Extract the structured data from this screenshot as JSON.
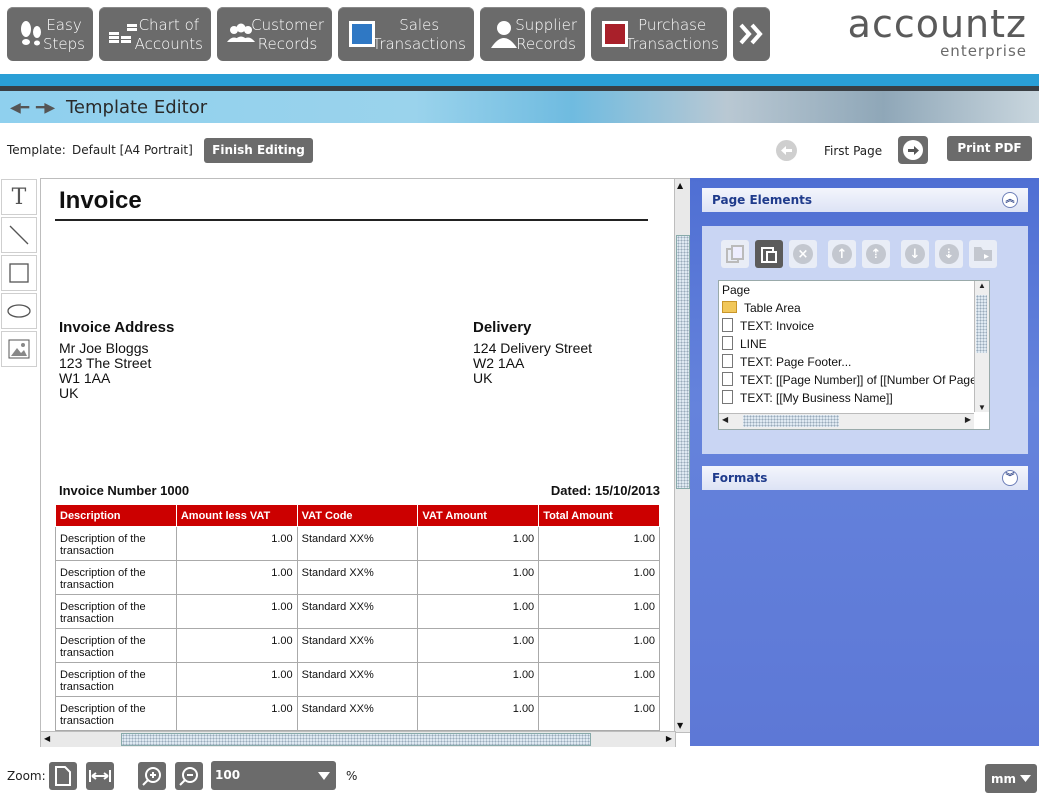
{
  "nav": {
    "items": [
      {
        "label_line1": "Easy",
        "label_line2": "Steps",
        "icon": "footprints-icon"
      },
      {
        "label_line1": "Chart of",
        "label_line2": "Accounts",
        "icon": "coin-stacks-icon"
      },
      {
        "label_line1": "Customer",
        "label_line2": "Records",
        "icon": "people-icon"
      },
      {
        "label_line1": "Sales",
        "label_line2": "Transactions",
        "icon": "blue-book-icon"
      },
      {
        "label_line1": "Supplier",
        "label_line2": "Records",
        "icon": "person-icon"
      },
      {
        "label_line1": "Purchase",
        "label_line2": "Transactions",
        "icon": "red-book-icon"
      }
    ],
    "more_icon": "double-chevron-right-icon"
  },
  "logo": {
    "name": "accountz",
    "edition": "enterprise"
  },
  "banner": {
    "title": "Template Editor"
  },
  "template_bar": {
    "template_label": "Template:",
    "template_value": "Default [A4 Portrait]",
    "finish_button": "Finish Editing",
    "page_label": "First Page",
    "print_button": "Print PDF"
  },
  "invoice": {
    "title": "Invoice",
    "address_heading": "Invoice Address",
    "address_lines": [
      "Mr Joe Bloggs",
      "123 The Street",
      "W1 1AA",
      "UK"
    ],
    "delivery_heading": "Delivery",
    "delivery_lines": [
      "124 Delivery Street",
      "W2 1AA",
      "UK"
    ],
    "number": "Invoice Number 1000",
    "dated": "Dated: 15/10/2013",
    "columns": [
      "Description",
      "Amount less VAT",
      "VAT Code",
      "VAT Amount",
      "Total Amount"
    ],
    "rows": [
      [
        "Description of the transaction",
        "1.00",
        "Standard XX%",
        "1.00",
        "1.00"
      ],
      [
        "Description of the transaction",
        "1.00",
        "Standard XX%",
        "1.00",
        "1.00"
      ],
      [
        "Description of the transaction",
        "1.00",
        "Standard XX%",
        "1.00",
        "1.00"
      ],
      [
        "Description of the transaction",
        "1.00",
        "Standard XX%",
        "1.00",
        "1.00"
      ],
      [
        "Description of the transaction",
        "1.00",
        "Standard XX%",
        "1.00",
        "1.00"
      ],
      [
        "Description of the transaction",
        "1.00",
        "Standard XX%",
        "1.00",
        "1.00"
      ]
    ]
  },
  "page_elements": {
    "heading": "Page Elements",
    "tree": [
      {
        "label": "Page",
        "kind": "root"
      },
      {
        "label": "Table Area",
        "kind": "folder"
      },
      {
        "label": "TEXT: Invoice",
        "kind": "doc"
      },
      {
        "label": "LINE",
        "kind": "doc"
      },
      {
        "label": "TEXT: Page Footer...",
        "kind": "doc"
      },
      {
        "label": "TEXT: [[Page Number]] of [[Number Of Pages]]",
        "kind": "doc"
      },
      {
        "label": "TEXT: [[My Business Name]]",
        "kind": "doc"
      }
    ]
  },
  "formats": {
    "heading": "Formats"
  },
  "zoom": {
    "label": "Zoom:",
    "value": "100",
    "unit": "%",
    "units_select": "mm"
  },
  "colors": {
    "accent_blue": "#2a9fd6",
    "table_header_red": "#cc0000",
    "button_gray": "#6b6b6b",
    "panel_blue": "#5d78d6"
  }
}
